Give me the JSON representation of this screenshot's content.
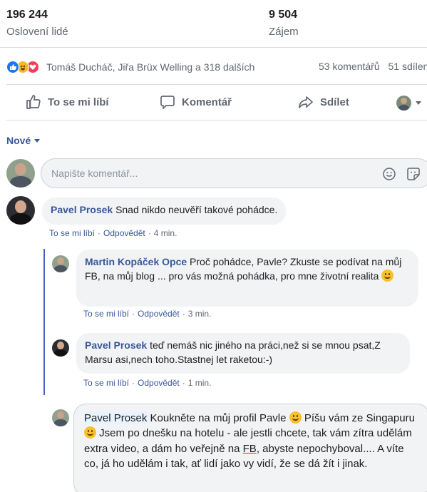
{
  "stats": {
    "reach_value": "196 244",
    "reach_label": "Oslovení lidé",
    "interest_value": "9 504",
    "interest_label": "Zájem"
  },
  "reactions": {
    "icons": [
      "like-icon",
      "haha-icon",
      "love-icon"
    ],
    "names": "Tomáš Ducháč, Jiřa Brüx Welling a 318 dalších",
    "comments": "53 komentářů",
    "shares": "51 sdílen"
  },
  "actions": {
    "like": "To se mi líbí",
    "comment": "Komentář",
    "share": "Sdílet"
  },
  "sort": {
    "label": "Nové"
  },
  "composer": {
    "placeholder": "Napište komentář..."
  },
  "comments": [
    {
      "author": "Pavel Prosek",
      "text": "Snad nikdo neuvěří takové pohádce.",
      "like": "To se mi líbí",
      "reply": "Odpovědět",
      "time": "4 min."
    }
  ],
  "replies": [
    {
      "author": "Martin Kopáček Opce",
      "text": "Proč pohádce, Pavle? Zkuste se podívat na můj FB, na můj blog ... pro vás možná pohádka, pro mne životní realita",
      "like": "To se mi líbí",
      "reply": "Odpovědět",
      "time": "3 min."
    },
    {
      "author": "Pavel Prosek",
      "text": "teď nemáš nic jiného na práci,než si se mnou psat,Z Marsu asi,nech toho.Stastnej let raketou:-)",
      "like": "To se mi líbí",
      "reply": "Odpovědět",
      "time": "1 min."
    }
  ],
  "draft_reply": {
    "mention": "Pavel Prosek",
    "part1": " Koukněte na můj profil Pavle ",
    "part2": " Píšu vám ze Singapuru ",
    "part3": " Jsem po dnešku na hotelu - ale jestli chcete, tak vám zítra udělám extra video, a dám ho veřejně na ",
    "fb": "FB",
    "part4": ", abyste nepochyboval.... A víte co, já ho udělám i tak, ať lidí jako vy vidí, že se dá žít i jinak."
  },
  "colors": {
    "link": "#385898",
    "like_blue": "#1877f2",
    "haha_yellow": "#f7b928",
    "love_red": "#f33e58",
    "thread_line": "#4267b2"
  }
}
